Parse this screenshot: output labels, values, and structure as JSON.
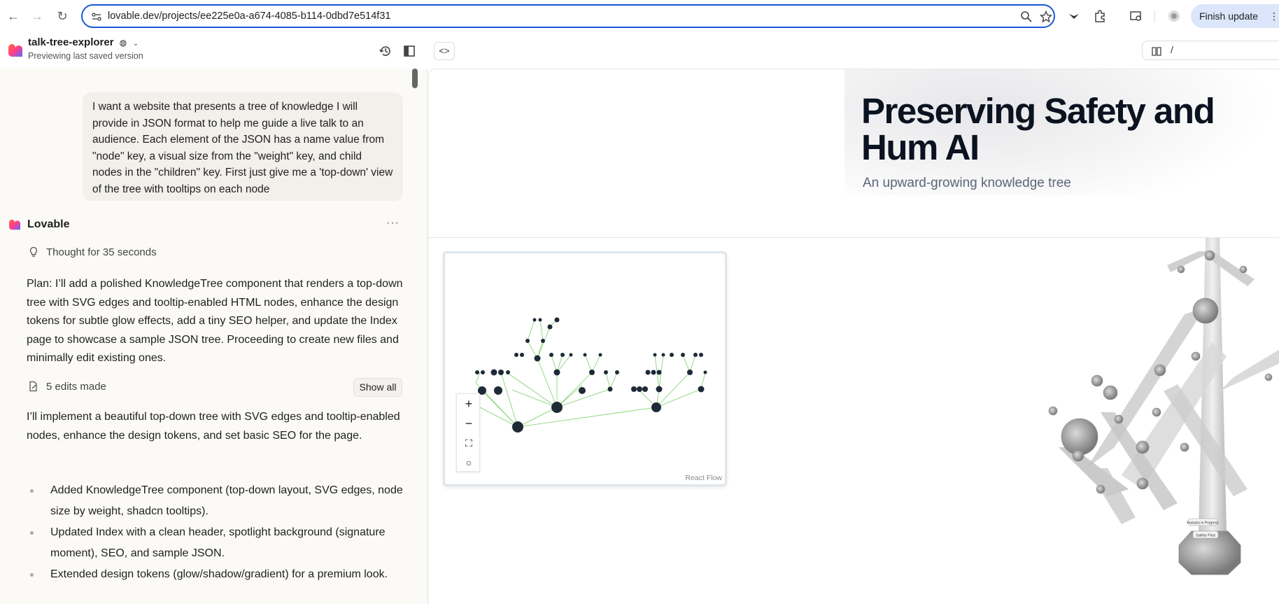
{
  "browser": {
    "url": "lovable.dev/projects/ee225e0a-a674-4085-b114-0dbd7e514f31",
    "finish_update_label": "Finish update"
  },
  "project": {
    "name": "talk-tree-explorer",
    "status": "Previewing last saved version"
  },
  "chat": {
    "user_message": "I want a website that presents a tree of knowledge I will provide in JSON format to help me guide a live talk to an audience. Each element of the JSON has a name value from \"node\" key, a visual size from the \"weight\" key, and child nodes in the \"children\" key. First just give me a 'top-down' view of the tree with tooltips on each node",
    "assistant_name": "Lovable",
    "thought": "Thought for 35 seconds",
    "plan": "Plan: I’ll add a polished KnowledgeTree component that renders a top-down tree with SVG edges and tooltip-enabled HTML nodes, enhance the design tokens for subtle glow effects, add a tiny SEO helper, and update the Index page to showcase a sample JSON tree. Proceeding to create new files and minimally edit existing ones.",
    "edits": "5 edits made",
    "show_all_label": "Show all",
    "implementation": "I’ll implement a beautiful top-down tree with SVG edges and tooltip-enabled nodes, enhance the design tokens, and set basic SEO for the page.",
    "bullets": [
      "Added KnowledgeTree component (top-down layout, SVG edges, node size by weight, shadcn tooltips).",
      "Updated Index with a clean header, spotlight background (signature moment), SEO, and sample JSON.",
      "Extended design tokens (glow/shadow/gradient) for a premium look."
    ]
  },
  "preview": {
    "path": "/",
    "title": "Preserving Safety and Hum AI",
    "subtitle": "An upward-growing knowledge tree",
    "flow_label": "React Flow",
    "tree_labels": {
      "root_a": "Safety First",
      "root_b": "Humans in Progress"
    }
  },
  "colors": {
    "accent": "#1a56db",
    "finish_bg": "#dbe6fb",
    "node_dark": "#1f2a37",
    "edge_green": "#7ccf6a"
  }
}
